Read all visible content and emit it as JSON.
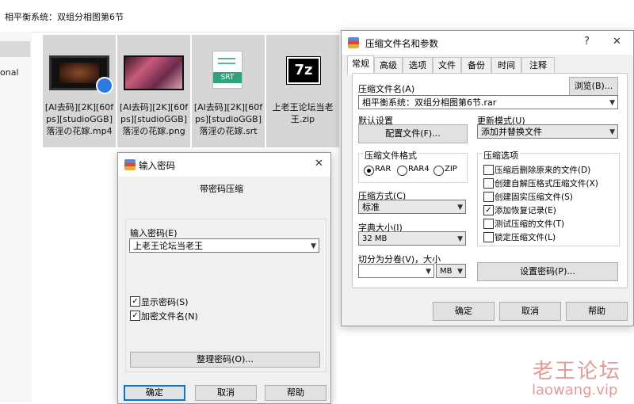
{
  "explorer": {
    "address": "相平衡系统：双组分相图第6节",
    "nav_label": "onal",
    "files": [
      {
        "name": "[AI去码][2K][60fps][studioGGB]落淫の花嫁.mp4",
        "icon": "video-icon"
      },
      {
        "name": "[AI去码][2K][60fps][studioGGB]落淫の花嫁.png",
        "icon": "image-icon"
      },
      {
        "name": "[AI去码][2K][60fps][studioGGB]落淫の花嫁.srt",
        "icon": "srt-icon",
        "icon_text": "SRT"
      },
      {
        "name": "上老王论坛当老王.zip",
        "icon": "7z-icon",
        "icon_text": "7z"
      }
    ]
  },
  "archive_dialog": {
    "title": "压缩文件名和参数",
    "help": "?",
    "close": "✕",
    "tabs": [
      "常规",
      "高级",
      "选项",
      "文件",
      "备份",
      "时间",
      "注释"
    ],
    "archive_name_label": "压缩文件名(A)",
    "browse_button": "浏览(B)...",
    "archive_name_value": "相平衡系统：双组分相图第6节.rar",
    "default_settings_label": "默认设置",
    "profiles_button": "配置文件(F)...",
    "update_mode_label": "更新模式(U)",
    "update_mode_value": "添加并替换文件",
    "format_group_label": "压缩文件格式",
    "format_options": [
      "RAR",
      "RAR4",
      "ZIP"
    ],
    "method_label": "压缩方式(C)",
    "method_value": "标准",
    "dict_label": "字典大小(I)",
    "dict_value": "32 MB",
    "split_label": "切分为分卷(V)，大小",
    "split_unit": "MB",
    "options_group_label": "压缩选项",
    "options": [
      {
        "label": "压缩后删除原来的文件(D)",
        "checked": false
      },
      {
        "label": "创建自解压格式压缩文件(X)",
        "checked": false
      },
      {
        "label": "创建固实压缩文件(S)",
        "checked": false
      },
      {
        "label": "添加恢复记录(E)",
        "checked": true
      },
      {
        "label": "测试压缩的文件(T)",
        "checked": false
      },
      {
        "label": "锁定压缩文件(L)",
        "checked": false
      }
    ],
    "set_password_button": "设置密码(P)...",
    "ok": "确定",
    "cancel": "取消",
    "help_button": "帮助"
  },
  "password_dialog": {
    "title": "输入密码",
    "close": "✕",
    "subtitle": "带密码压缩",
    "enter_label": "输入密码(E)",
    "password_value": "上老王论坛当老王",
    "show_password_label": "显示密码(S)",
    "encrypt_names_label": "加密文件名(N)",
    "organize_button": "整理密码(O)...",
    "ok": "确定",
    "cancel": "取消",
    "help_button": "帮助"
  },
  "watermark": {
    "line1": "老王论坛",
    "line2": "laowang.vip"
  },
  "colors": {
    "accent": "#0078d7",
    "watermark": "#e59a9a"
  }
}
